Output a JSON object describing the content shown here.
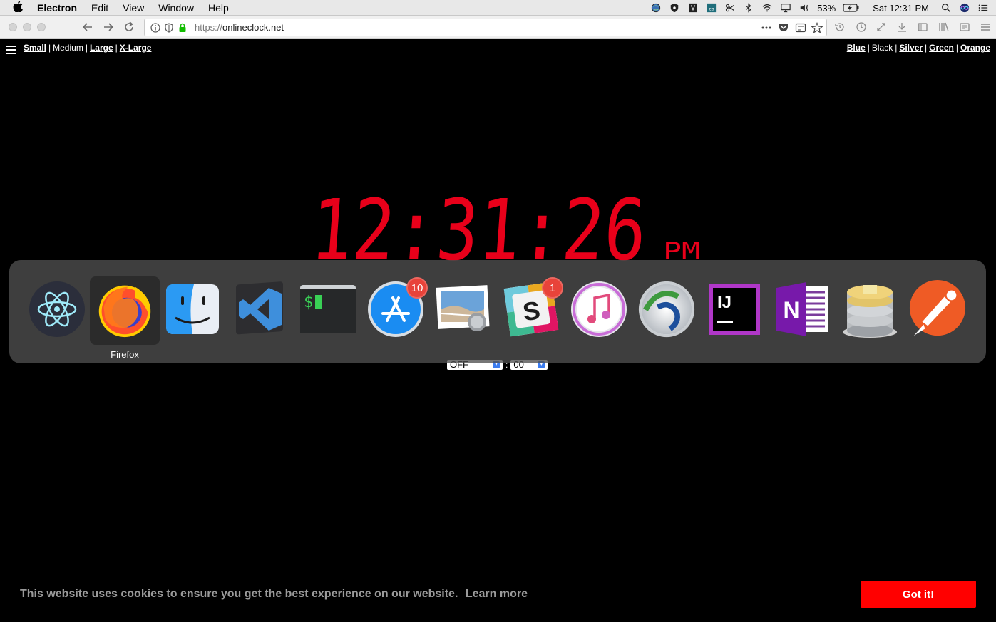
{
  "menubar": {
    "app_name": "Electron",
    "menus": [
      "Edit",
      "View",
      "Window",
      "Help"
    ],
    "battery": "53%",
    "clock": "Sat 12:31 PM"
  },
  "browser": {
    "url_scheme": "https://",
    "url_host": "onlineclock.net"
  },
  "page": {
    "sizes": [
      {
        "label": "Small",
        "current": false
      },
      {
        "label": "Medium",
        "current": true
      },
      {
        "label": "Large",
        "current": false
      },
      {
        "label": "X-Large",
        "current": false
      }
    ],
    "colors": [
      {
        "label": "Blue",
        "current": false
      },
      {
        "label": "Black",
        "current": true
      },
      {
        "label": "Silver",
        "current": false
      },
      {
        "label": "Green",
        "current": false
      },
      {
        "label": "Orange",
        "current": false
      }
    ],
    "clock_digits": "12:31:26",
    "clock_ampm": "PM",
    "clock_color": "#e8001a",
    "alarm_hour": "OFF",
    "alarm_minute": "00"
  },
  "dock": {
    "apps": [
      {
        "name": "electron-icon",
        "badge": ""
      },
      {
        "name": "firefox-icon",
        "badge": ""
      },
      {
        "name": "finder-icon",
        "badge": ""
      },
      {
        "name": "vscode-icon",
        "badge": ""
      },
      {
        "name": "terminal-icon",
        "badge": ""
      },
      {
        "name": "app-store-icon",
        "badge": "10"
      },
      {
        "name": "preview-icon",
        "badge": ""
      },
      {
        "name": "slack-icon",
        "badge": "1"
      },
      {
        "name": "itunes-icon",
        "badge": ""
      },
      {
        "name": "cisco-anyconnect-icon",
        "badge": ""
      },
      {
        "name": "intellij-icon",
        "badge": ""
      },
      {
        "name": "onenote-icon",
        "badge": ""
      },
      {
        "name": "sequel-pro-icon",
        "badge": ""
      },
      {
        "name": "postman-icon",
        "badge": ""
      }
    ],
    "selected_label": "Firefox"
  },
  "cookie": {
    "message": "This website uses cookies to ensure you get the best experience on our website.",
    "learn_more": "Learn more",
    "button": "Got it!"
  }
}
